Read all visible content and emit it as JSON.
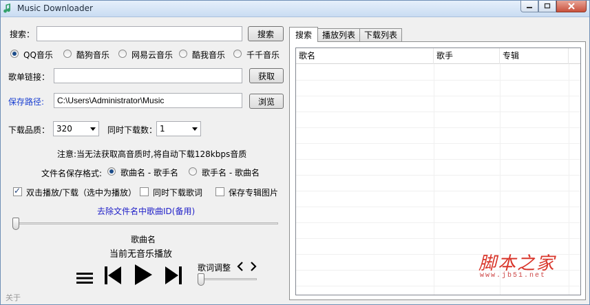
{
  "window": {
    "title": "Music Downloader"
  },
  "search": {
    "label": "搜索：",
    "value": "",
    "button": "搜索"
  },
  "sources": [
    {
      "label": "QQ音乐",
      "selected": true
    },
    {
      "label": "酷狗音乐",
      "selected": false
    },
    {
      "label": "网易云音乐",
      "selected": false
    },
    {
      "label": "酷我音乐",
      "selected": false
    },
    {
      "label": "千千音乐",
      "selected": false
    }
  ],
  "playlist_link": {
    "label": "歌单链接：",
    "value": "",
    "button": "获取"
  },
  "save_path": {
    "label": "保存路径:",
    "value": "C:\\Users\\Administrator\\Music",
    "button": "浏览"
  },
  "quality": {
    "label": "下载品质：",
    "value": "320"
  },
  "concurrency": {
    "label": "同时下载数：",
    "value": "1"
  },
  "notice": "注意:当无法获取高音质时,将自动下载128kbps音质",
  "filename_format": {
    "label": "文件名保存格式:",
    "options": [
      {
        "label": "歌曲名 - 歌手名",
        "selected": true
      },
      {
        "label": "歌手名 - 歌曲名",
        "selected": false
      }
    ]
  },
  "options": [
    {
      "label": "双击播放/下载（选中为播放）",
      "checked": true
    },
    {
      "label": "同时下载歌词",
      "checked": false
    },
    {
      "label": "保存专辑图片",
      "checked": false
    }
  ],
  "remove_id_link": "去除文件名中歌曲ID(备用)",
  "player": {
    "progress": 0,
    "song_label": "歌曲名",
    "status": "当前无音乐播放",
    "lyrics_adjust_label": "歌词调整",
    "lyrics_offset": 0
  },
  "about": "关于",
  "tabs": [
    {
      "label": "搜索",
      "active": true
    },
    {
      "label": "播放列表",
      "active": false
    },
    {
      "label": "下载列表",
      "active": false
    }
  ],
  "table": {
    "columns": [
      "歌名",
      "歌手",
      "专辑"
    ],
    "rows": []
  },
  "watermark": {
    "text": "脚本之家",
    "url": "www.jb51.net"
  },
  "colors": {
    "accent": "#1a3fd1",
    "link": "#2020c8",
    "watermark": "#d9362b"
  }
}
